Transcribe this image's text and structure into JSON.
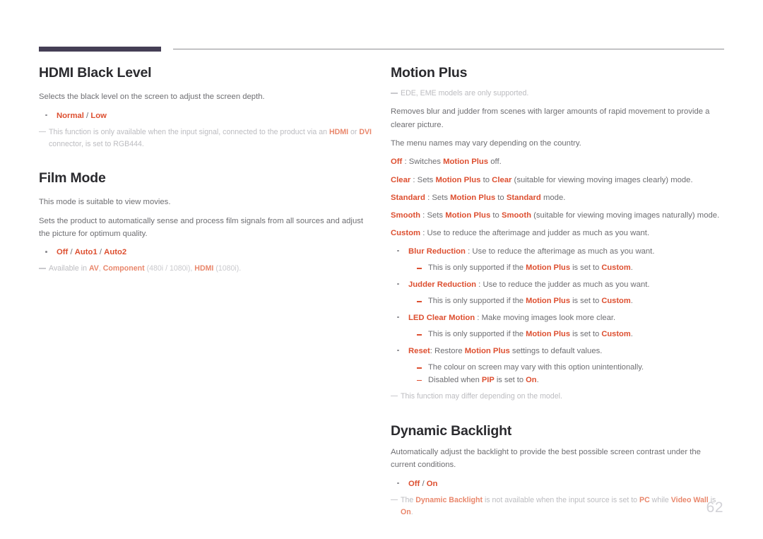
{
  "document": {
    "page_number": "62",
    "accent_color": "#dd4f30",
    "header_bar_color": "#453f55",
    "note_color": "#bcbcc0"
  },
  "left_column": {
    "hdmi_black_level": {
      "title": "HDMI Black Level",
      "intro": "Selects the black level on the screen to adjust the screen depth.",
      "option": {
        "normal": "Normal",
        "separator": " / ",
        "low": "Low"
      },
      "note": {
        "part1": "This function is only available when the input signal, connected to the product via an ",
        "kw1": "HDMI",
        "part2": " or ",
        "kw2": "DVI",
        "part3": " connector, is set to RGB444."
      }
    },
    "film_mode": {
      "title": "Film Mode",
      "intro1": "This mode is suitable to view movies.",
      "intro2": "Sets the product to automatically sense and process film signals from all sources and adjust the picture for optimum quality.",
      "option": {
        "off": "Off",
        "sep1": " / ",
        "auto1": "Auto1",
        "sep2": " / ",
        "auto2": "Auto2"
      },
      "note": {
        "part1": "Available in ",
        "kw1": "AV",
        "part2": ", ",
        "kw2": "Component",
        "part3": " (480i / 1080i), ",
        "kw3": "HDMI",
        "part4": " (1080i)."
      }
    }
  },
  "right_column": {
    "motion_plus": {
      "title": "Motion Plus",
      "note_models": "EDE, EME models are only supported.",
      "intro1": "Removes blur and judder from scenes with larger amounts of rapid movement to provide a clearer picture.",
      "intro2": "The menu names may vary depending on the country.",
      "modes": [
        {
          "kw": "Off",
          "t1": " : Switches ",
          "kw2": "Motion Plus",
          "t2": " off."
        },
        {
          "kw": "Clear",
          "t1": " : Sets ",
          "kw2": "Motion Plus",
          "t2": " to ",
          "kw3": "Clear",
          "t3": " (suitable for viewing moving images clearly) mode."
        },
        {
          "kw": "Standard",
          "t1": " : Sets ",
          "kw2": "Motion Plus",
          "t2": " to ",
          "kw3": "Standard",
          "t3": " mode."
        },
        {
          "kw": "Smooth",
          "t1": " : Sets ",
          "kw2": "Motion Plus",
          "t2": " to ",
          "kw3": "Smooth",
          "t3": " (suitable for viewing moving images naturally) mode."
        },
        {
          "kw": "Custom",
          "t1": " : Use to reduce the afterimage and judder as much as you want.",
          "kw2": "",
          "t2": ""
        }
      ],
      "sub_items": {
        "blur_reduction": {
          "kw": "Blur Reduction",
          "text": " : Use to reduce the afterimage as much as you want.",
          "sub": {
            "part1": "This is only supported if the ",
            "kw1": "Motion Plus",
            "part2": " is set to ",
            "kw2": "Custom",
            "part3": "."
          }
        },
        "judder_reduction": {
          "kw": "Judder Reduction",
          "text": " : Use to reduce the judder as much as you want.",
          "sub": {
            "part1": "This is only supported if the ",
            "kw1": "Motion Plus",
            "part2": " is set to ",
            "kw2": "Custom",
            "part3": "."
          }
        },
        "led_clear_motion": {
          "kw": "LED Clear Motion",
          "text": " : Make moving images look more clear.",
          "sub": {
            "part1": "This is only supported if the ",
            "kw1": "Motion Plus",
            "part2": " is set to ",
            "kw2": "Custom",
            "part3": "."
          }
        },
        "reset": {
          "kw": "Reset",
          "text1": ": Restore ",
          "kw2": "Motion Plus",
          "text2": " settings to default values.",
          "sub1": "The colour on screen may vary with this option unintentionally.",
          "sub2": {
            "part1": "Disabled when ",
            "kw1": "PIP",
            "part2": " is set to ",
            "kw2": "On",
            "part3": "."
          }
        }
      },
      "note_model_differ": "This function may differ depending on the model."
    },
    "dynamic_backlight": {
      "title": "Dynamic Backlight",
      "intro": "Automatically adjust the backlight to provide the best possible screen contrast under the current conditions.",
      "option": {
        "off": "Off",
        "separator": " / ",
        "on": "On"
      },
      "note": {
        "part1": "The ",
        "kw1": "Dynamic Backlight",
        "part2": " is not available when the input source is set to ",
        "kw2": "PC",
        "part3": " while ",
        "kw3": "Video Wall",
        "part4": " is ",
        "kw4": "On",
        "part5": "."
      }
    }
  }
}
